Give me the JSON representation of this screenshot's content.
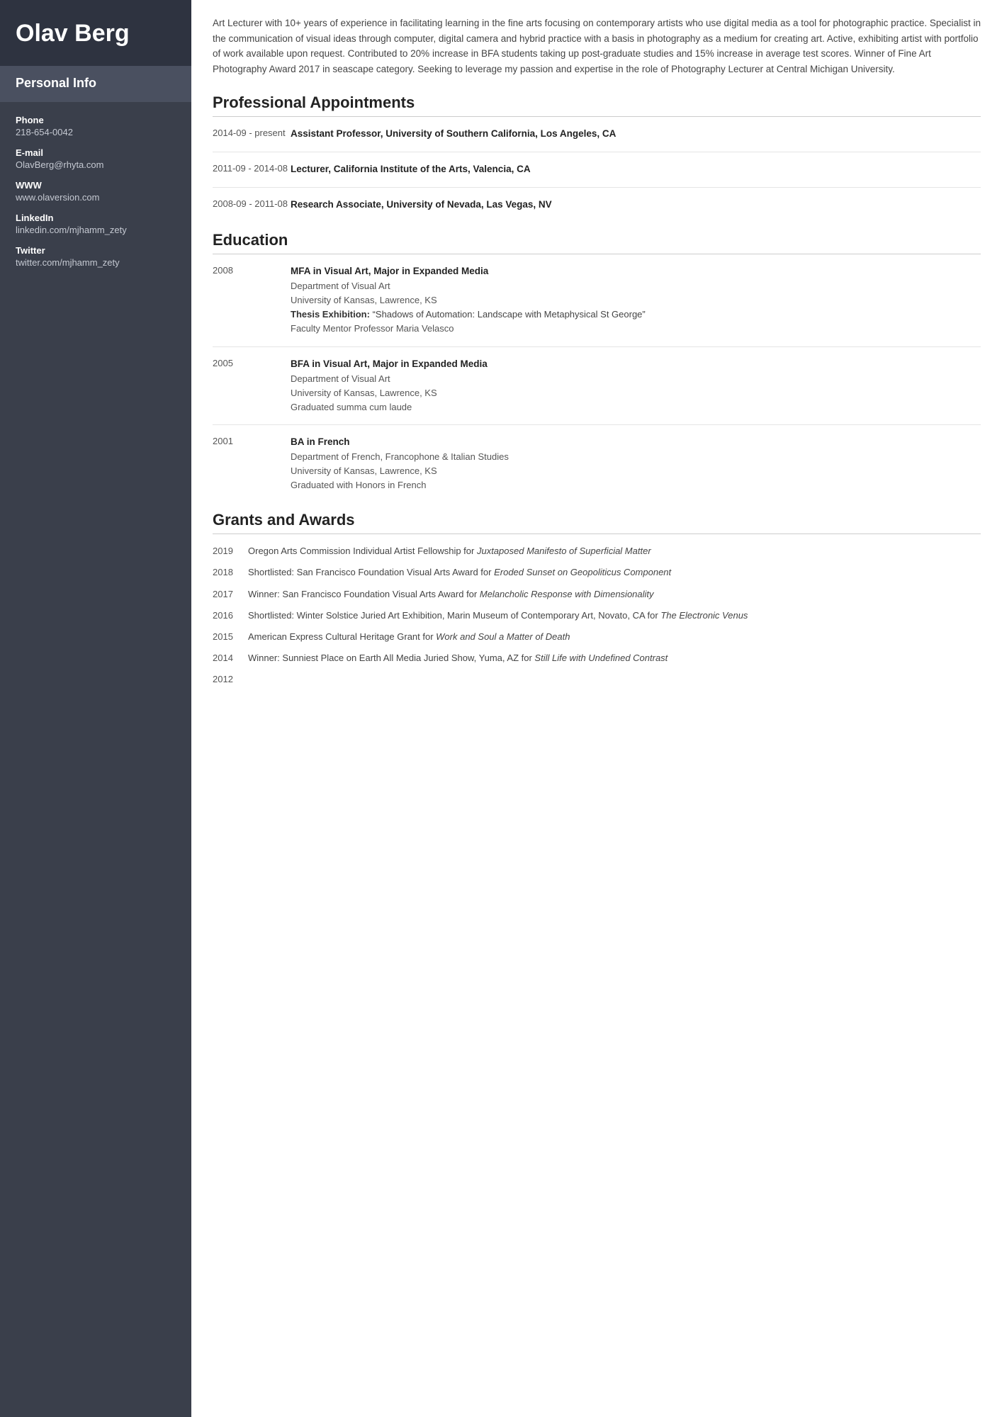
{
  "sidebar": {
    "name": "Olav Berg",
    "personal_info_label": "Personal Info",
    "fields": [
      {
        "label": "Phone",
        "value": "218-654-0042"
      },
      {
        "label": "E-mail",
        "value": "OlavBerg@rhyta.com"
      },
      {
        "label": "WWW",
        "value": "www.olaversion.com"
      },
      {
        "label": "LinkedIn",
        "value": "linkedin.com/mjhamm_zety"
      },
      {
        "label": "Twitter",
        "value": "twitter.com/mjhamm_zety"
      }
    ]
  },
  "summary": "Art Lecturer with 10+ years of experience in facilitating learning in the fine arts focusing on contemporary artists who use digital media as a tool for photographic practice. Specialist in the communication of visual ideas through computer, digital camera and hybrid practice with a basis in photography as a medium for creating art. Active, exhibiting artist with portfolio of work available upon request. Contributed to 20% increase in BFA students taking up post-graduate studies and 15% increase in average test scores. Winner of Fine Art Photography Award 2017 in seascape category. Seeking to leverage my passion and expertise in the role of Photography Lecturer at Central Michigan University.",
  "sections": {
    "appointments": {
      "title": "Professional Appointments",
      "entries": [
        {
          "date": "2014-09 - present",
          "title": "Assistant Professor, University of Southern California, Los Angeles, CA",
          "details": []
        },
        {
          "date": "2011-09 - 2014-08",
          "title": "Lecturer, California Institute of the Arts, Valencia, CA",
          "details": []
        },
        {
          "date": "2008-09 - 2011-08",
          "title": "Research Associate, University of Nevada, Las Vegas, NV",
          "details": []
        }
      ]
    },
    "education": {
      "title": "Education",
      "entries": [
        {
          "date": "2008",
          "title": "MFA in Visual Art, Major in Expanded Media",
          "details": [
            "Department of Visual Art",
            "University of Kansas, Lawrence, KS",
            "Thesis Exhibition: “Shadows of Automation: Landscape with Metaphysical St George”",
            "Faculty Mentor Professor Maria Velasco"
          ],
          "thesis_index": 2
        },
        {
          "date": "2005",
          "title": "BFA in Visual Art, Major in Expanded Media",
          "details": [
            "Department of Visual Art",
            "University of Kansas, Lawrence, KS",
            "Graduated summa cum laude"
          ],
          "thesis_index": -1
        },
        {
          "date": "2001",
          "title": "BA in French",
          "details": [
            "Department of French, Francophone & Italian Studies",
            "University of Kansas, Lawrence, KS",
            "Graduated with Honors in French"
          ],
          "thesis_index": -1
        }
      ]
    },
    "grants": {
      "title": "Grants and Awards",
      "entries": [
        {
          "year": "2019",
          "text": "Oregon Arts Commission Individual Artist Fellowship for ",
          "italic": "Juxtaposed Manifesto of Superficial Matter",
          "after": ""
        },
        {
          "year": "2018",
          "text": "Shortlisted: San Francisco Foundation Visual Arts Award for ",
          "italic": "Eroded Sunset on Geopoliticus Component",
          "after": ""
        },
        {
          "year": "2017",
          "text": "Winner: San Francisco Foundation Visual Arts Award for ",
          "italic": "Melancholic Response with Dimensionality",
          "after": ""
        },
        {
          "year": "2016",
          "text": "Shortlisted: Winter Solstice Juried Art Exhibition, Marin Museum of Contemporary Art, Novato, CA for ",
          "italic": "The Electronic Venus",
          "after": ""
        },
        {
          "year": "2015",
          "text": "American Express Cultural Heritage Grant for ",
          "italic": "Work and Soul a Matter of Death",
          "after": ""
        },
        {
          "year": "2014",
          "text": "Winner: Sunniest Place on Earth All Media Juried Show, Yuma, AZ for ",
          "italic": "Still Life with Undefined Contrast",
          "after": ""
        },
        {
          "year": "2012",
          "text": "",
          "italic": "",
          "after": ""
        }
      ]
    }
  }
}
